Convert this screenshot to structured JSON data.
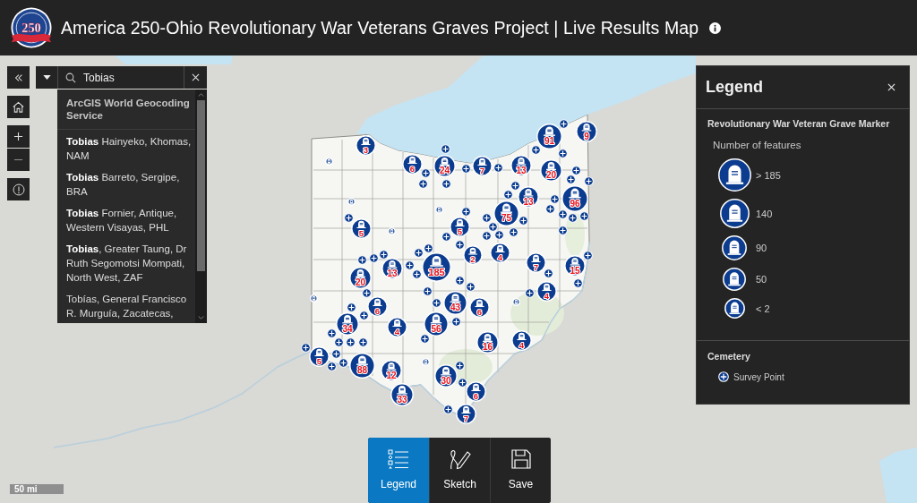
{
  "header": {
    "logo_text": "250",
    "title": "America 250-Ohio Revolutionary War Veterans Graves Project | Live Results Map"
  },
  "search": {
    "value": "Tobias",
    "source": "ArcGIS World Geocoding Service",
    "suggestions": [
      "**Tobias** Hainyeko, Khomas, NAM",
      "**Tobias** Barreto, Sergipe, BRA",
      "**Tobias** Fornier, Antique, Western Visayas, PHL",
      "**Tobias**, Greater Taung, Dr Ruth Segomotsi Mompati, North West, ZAF",
      "Tobías, General Francisco R. Murguía, Zacatecas,"
    ]
  },
  "map": {
    "clusters": [
      {
        "count": "3"
      },
      {
        "count": "91"
      },
      {
        "count": "9"
      },
      {
        "count": "6"
      },
      {
        "count": "24"
      },
      {
        "count": "7"
      },
      {
        "count": "13"
      },
      {
        "count": "20"
      },
      {
        "count": "13"
      },
      {
        "count": "96"
      },
      {
        "count": "75"
      },
      {
        "count": "5"
      },
      {
        "count": "5"
      },
      {
        "count": "2"
      },
      {
        "count": "4"
      },
      {
        "count": "20"
      },
      {
        "count": "13"
      },
      {
        "count": "185"
      },
      {
        "count": "7"
      },
      {
        "count": "15"
      },
      {
        "count": "4"
      },
      {
        "count": "6"
      },
      {
        "count": "43"
      },
      {
        "count": "6"
      },
      {
        "count": "34"
      },
      {
        "count": "4"
      },
      {
        "count": "56"
      },
      {
        "count": "16"
      },
      {
        "count": "4"
      },
      {
        "count": "5"
      },
      {
        "count": "88"
      },
      {
        "count": "12"
      },
      {
        "count": "30"
      },
      {
        "count": "33"
      },
      {
        "count": "6"
      },
      {
        "count": "7"
      }
    ],
    "scale": "50 mi"
  },
  "legend": {
    "title": "Legend",
    "layers": [
      {
        "kind": "sized",
        "title": "Revolutionary War Veteran Grave Marker",
        "subtitle": "Number of features",
        "classes": [
          "> 185",
          "140",
          "90",
          "50",
          "< 2"
        ]
      },
      {
        "kind": "symbol",
        "title": "Cemetery",
        "items": [
          "Survey Point"
        ]
      }
    ]
  },
  "toolbar": [
    {
      "label": "Legend",
      "selected": true
    },
    {
      "label": "Sketch",
      "selected": false
    },
    {
      "label": "Save",
      "selected": false
    }
  ]
}
